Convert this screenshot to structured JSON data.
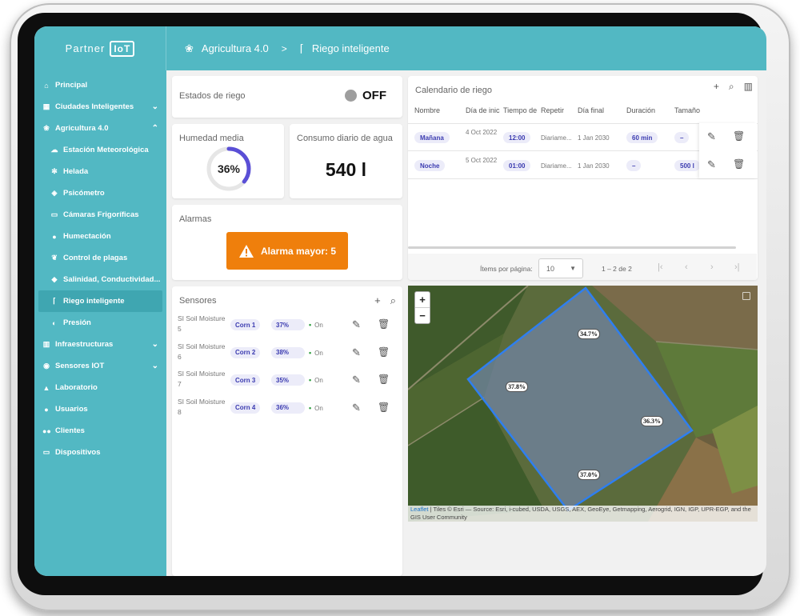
{
  "app": {
    "brand": "Partner",
    "brand_mark": "IoT"
  },
  "breadcrumb": [
    "Agricultura 4.0",
    "Riego inteligente"
  ],
  "sidebar": {
    "items": [
      {
        "label": "Principal",
        "icon": "home-icon"
      },
      {
        "label": "Ciudades Inteligentes",
        "icon": "city-icon",
        "expand": "down"
      },
      {
        "label": "Agricultura 4.0",
        "icon": "agriculture-icon",
        "expand": "up"
      },
      {
        "label": "Estación Meteorológica",
        "icon": "cloud-icon",
        "sub": true
      },
      {
        "label": "Helada",
        "icon": "snowflake-icon",
        "sub": true
      },
      {
        "label": "Psicómetro",
        "icon": "gauge-icon",
        "sub": true
      },
      {
        "label": "Cámaras Frigoríficas",
        "icon": "monitor-icon",
        "sub": true
      },
      {
        "label": "Humectación",
        "icon": "drop-icon",
        "sub": true
      },
      {
        "label": "Control de plagas",
        "icon": "leaf-icon",
        "sub": true
      },
      {
        "label": "Salinidad, Conductividad...",
        "icon": "waterdrop-icon",
        "sub": true
      },
      {
        "label": "Riego inteligente",
        "icon": "sprinkler-icon",
        "sub": true,
        "active": true
      },
      {
        "label": "Presión",
        "icon": "pressure-icon",
        "sub": true
      },
      {
        "label": "Infraestructuras",
        "icon": "building-icon",
        "expand": "down"
      },
      {
        "label": "Sensores IOT",
        "icon": "sensor-icon",
        "expand": "down"
      },
      {
        "label": "Laboratorio",
        "icon": "flask-icon"
      },
      {
        "label": "Usuarios",
        "icon": "user-icon"
      },
      {
        "label": "Clientes",
        "icon": "group-icon"
      },
      {
        "label": "Dispositivos",
        "icon": "devices-icon"
      }
    ]
  },
  "irrigation_state": {
    "title": "Estados de riego",
    "value": "OFF"
  },
  "humidity": {
    "title": "Humedad media",
    "value": "36%",
    "fraction": 0.36
  },
  "water": {
    "title": "Consumo diario de agua",
    "value": "540 l"
  },
  "alarms": {
    "title": "Alarmas",
    "button": "Alarma mayor: 5"
  },
  "sensors": {
    "title": "Sensores",
    "rows": [
      {
        "name": "SI Soil Moisture 5",
        "crop": "Corn 1",
        "pct": "37%",
        "status": "On"
      },
      {
        "name": "SI Soil Moisture 6",
        "crop": "Corn 2",
        "pct": "38%",
        "status": "On"
      },
      {
        "name": "SI Soil Moisture 7",
        "crop": "Corn 3",
        "pct": "35%",
        "status": "On"
      },
      {
        "name": "SI Soil Moisture 8",
        "crop": "Corn 4",
        "pct": "36%",
        "status": "On"
      }
    ]
  },
  "calendar": {
    "title": "Calendario de riego",
    "headers": [
      "Nombre",
      "Día de inic",
      "Tiempo de",
      "Repetir",
      "Día final",
      "Duración",
      "Tamaño"
    ],
    "rows": [
      {
        "name": "Mañana",
        "start": "4 Oct 2022",
        "time": "12:00",
        "repeat": "Diariame...",
        "end": "1 Jan 2030",
        "duration": "60 min",
        "size": "–"
      },
      {
        "name": "Noche",
        "start": "5 Oct 2022",
        "time": "01:00",
        "repeat": "Diariame...",
        "end": "1 Jan 2030",
        "duration": "–",
        "size": "500 l"
      }
    ],
    "pagination": {
      "label": "Ítems por página:",
      "per_page": "10",
      "range": "1 – 2 de 2"
    }
  },
  "map": {
    "zoom_in": "+",
    "zoom_out": "−",
    "labels": [
      "34.7%",
      "37.8%",
      "36.3%",
      "37.0%"
    ],
    "attribution_link": "Leaflet",
    "attribution": "| Tiles © Esri — Source: Esri, i-cubed, USDA, USGS, AEX, GeoEye, Getmapping, Aerogrid, IGN, IGP, UPR-EGP, and the GIS User Community",
    "polygon_color": "#2f7ff0"
  },
  "colors": {
    "accent": "#52b8c3",
    "alarm": "#ef7f0c",
    "gauge": "#5a4fd6"
  }
}
